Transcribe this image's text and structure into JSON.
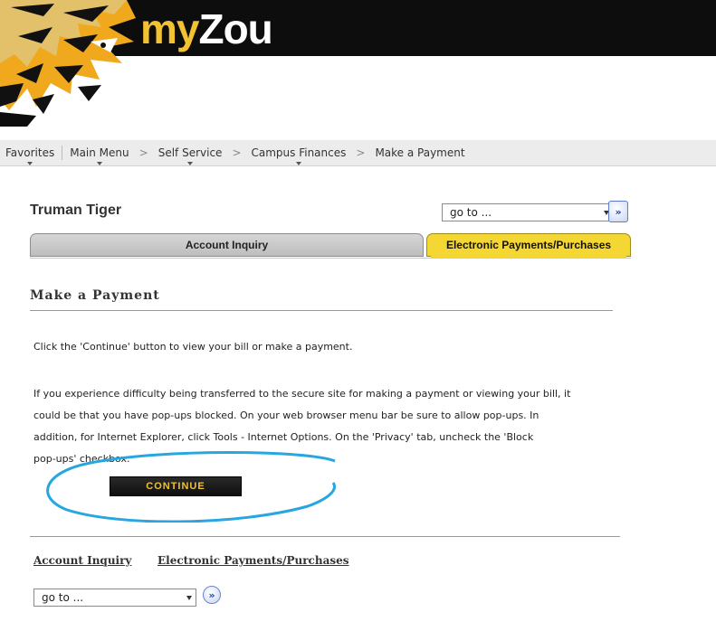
{
  "header": {
    "brand_my": "my",
    "brand_zou": "Zou",
    "logo_icon": "tiger-mascot"
  },
  "menubar": {
    "items": [
      "Favorites",
      "Main Menu",
      "Self Service",
      "Campus Finances",
      "Make a Payment"
    ],
    "separator": ">"
  },
  "user": {
    "name": "Truman Tiger"
  },
  "goto_top": {
    "value": "go to ..."
  },
  "tabs": {
    "account_inquiry": "Account Inquiry",
    "electronic_payments": "Electronic Payments/Purchases"
  },
  "main": {
    "title": "Make a Payment",
    "instruction": "Click the 'Continue' button to view your bill or make a payment.",
    "help_lines": [
      "If you experience difficulty being transferred to the secure site for making a payment or viewing your bill, it",
      "could be that you have pop-ups blocked.  On your web browser menu bar be sure to allow pop-ups.  In",
      "addition, for Internet Explorer, click Tools - Internet Options. On the 'Privacy' tab, uncheck the 'Block",
      "pop-ups' checkbox."
    ],
    "continue_label": "CONTINUE"
  },
  "footer": {
    "links": [
      "Account Inquiry",
      "Electronic Payments/Purchases"
    ],
    "goto_value": "go to ..."
  },
  "colors": {
    "brand_gold": "#f2c230",
    "header_black": "#0d0d0d",
    "annotation_blue": "#27a6e0",
    "tab_active": "#f4d732"
  },
  "go_button_glyph": "»"
}
